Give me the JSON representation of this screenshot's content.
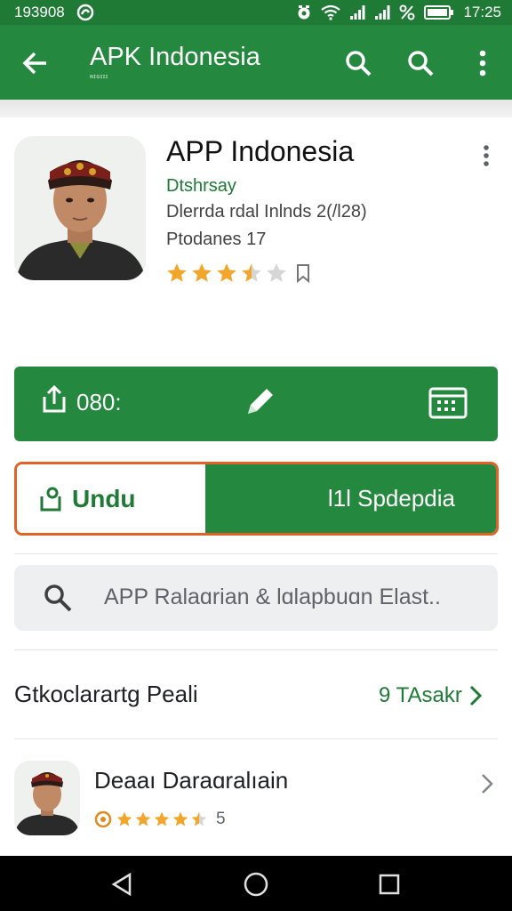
{
  "status_bar": {
    "left_text": "193908",
    "time": "17:25",
    "icons": [
      "notification-icon",
      "alarm-icon",
      "wifi-icon",
      "signal-icon",
      "signal-icon",
      "percent-icon",
      "battery-icon"
    ]
  },
  "app_bar": {
    "title": "APK Indonesia",
    "subtitle": "ɴɪɢɪɪɪ",
    "icons": [
      "back-arrow-icon",
      "search-icon",
      "search-icon",
      "more-vertical-icon"
    ]
  },
  "app": {
    "title": "APP Indonesia",
    "developer": "Dtshrsay",
    "info_line": "Dlerrda rdal Inlnds 2(/l28)",
    "downloads_line": "Ptodanes 17",
    "rating": 3.5,
    "rating_max": 5,
    "icon": "person-avatar-icon"
  },
  "action_bar": {
    "share_label": "080:",
    "icons": [
      "share-icon",
      "edit-pencil-icon",
      "calendar-icon"
    ]
  },
  "install": {
    "download_label": "Undu",
    "open_label": "l1l Spdepdia",
    "colors": {
      "border": "#e06224",
      "primary": "#24893f"
    }
  },
  "search": {
    "text": "APP Ralaɑrian & lɑlapbuɑn Elast.."
  },
  "section": {
    "title": "Gtkoclarartg Peali",
    "link_label": "9 TAsakr"
  },
  "list_item": {
    "name": "Deaaı Daraɑralıain",
    "rating": 4.5,
    "rating_count": "5"
  },
  "colors": {
    "accent": "#24893f",
    "status_bar": "#1f7a36",
    "star": "#f2a72c"
  }
}
